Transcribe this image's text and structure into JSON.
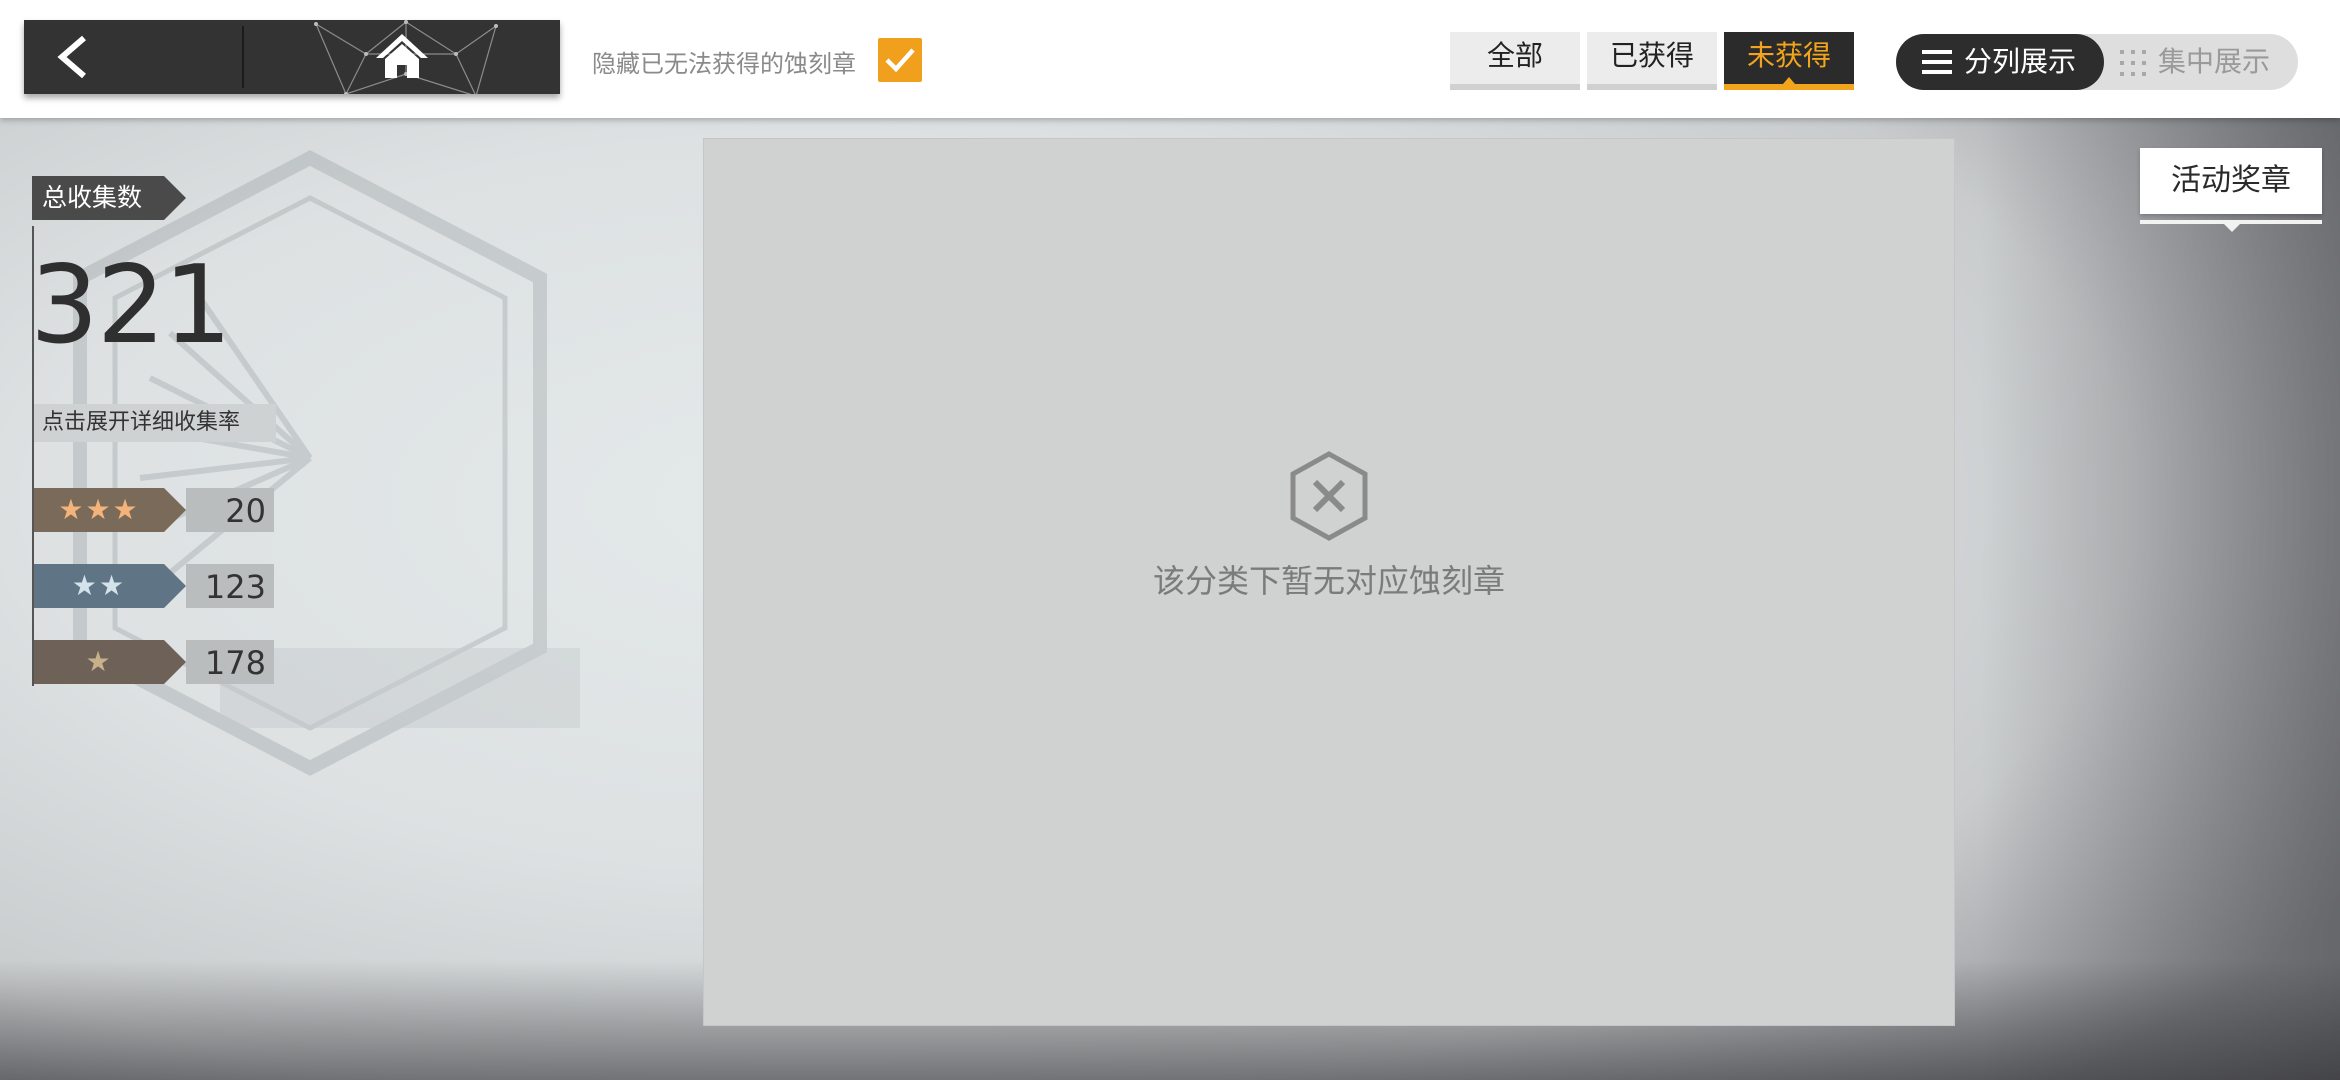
{
  "topbar": {
    "hide_unobtainable_label": "隐藏已无法获得的蚀刻章",
    "hide_unobtainable_checked": true,
    "filter_tabs": [
      {
        "label": "全部",
        "active": false
      },
      {
        "label": "已获得",
        "active": false
      },
      {
        "label": "未获得",
        "active": true
      }
    ],
    "view_modes": {
      "list_label": "分列展示",
      "grid_label": "集中展示",
      "active": "list"
    },
    "icons": {
      "back": "chevron-left-icon",
      "home": "home-icon"
    }
  },
  "stats": {
    "total_label": "总收集数",
    "total_count": "321",
    "expand_label": "点击展开详细收集率",
    "rarities": [
      {
        "stars": "★★★",
        "count": "20"
      },
      {
        "stars": "★★",
        "count": "123"
      },
      {
        "stars": "★",
        "count": "178"
      }
    ]
  },
  "content": {
    "empty_message": "该分类下暂无对应蚀刻章",
    "empty_icon": "hexagon-x-icon"
  },
  "side_tab": {
    "label": "活动奖章"
  },
  "colors": {
    "accent": "#f3a41d",
    "dark": "#2d2d2d"
  }
}
